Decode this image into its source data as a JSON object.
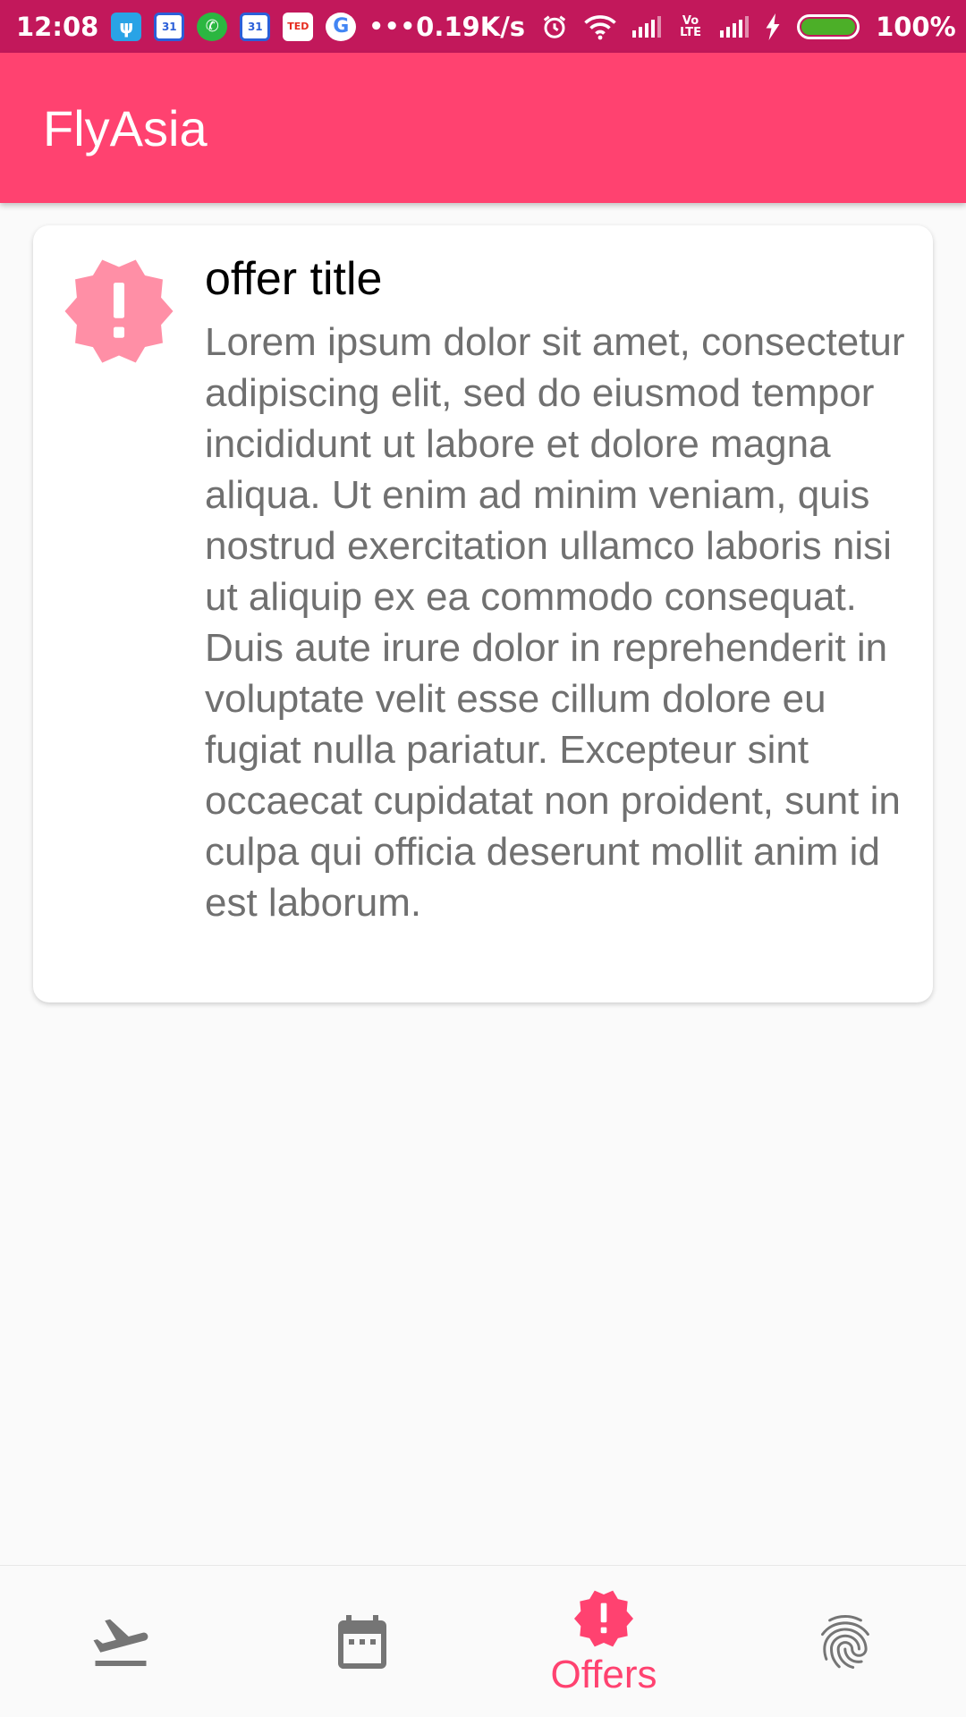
{
  "status_bar": {
    "time": "12:08",
    "network_speed": "0.19K/s",
    "battery": "100%",
    "overflow": "•••",
    "volte": "Vo LTE",
    "app_icons": [
      "usb-icon",
      "calendar-icon",
      "whatsapp-icon",
      "calendar-icon",
      "ted-icon",
      "google-icon"
    ]
  },
  "app_bar": {
    "title": "FlyAsia"
  },
  "offer": {
    "title": "offer title",
    "body": "Lorem ipsum dolor sit amet, consectetur adipiscing elit, sed do eiusmod tempor incididunt ut labore et dolore magna aliqua. Ut enim ad minim veniam, quis nostrud exercitation ullamco laboris nisi ut aliquip ex ea commodo consequat. Duis aute irure dolor in reprehenderit in voluptate velit esse cillum dolore eu fugiat nulla pariatur. Excepteur sint occaecat cupidatat non proident, sunt in culpa qui officia deserunt mollit anim id est laborum.",
    "badge_icon": "new-releases-icon"
  },
  "bottom_nav": {
    "items": [
      {
        "icon": "flight-takeoff-icon",
        "label": "",
        "active": false
      },
      {
        "icon": "calendar-icon",
        "label": "",
        "active": false
      },
      {
        "icon": "new-releases-icon",
        "label": "Offers",
        "active": true
      },
      {
        "icon": "fingerprint-icon",
        "label": "",
        "active": false
      }
    ]
  },
  "colors": {
    "primary": "#ff4270",
    "status_bar": "#c2185b",
    "badge": "#ff8fa6",
    "inactive_icon": "#757575",
    "body_text": "#707070"
  }
}
